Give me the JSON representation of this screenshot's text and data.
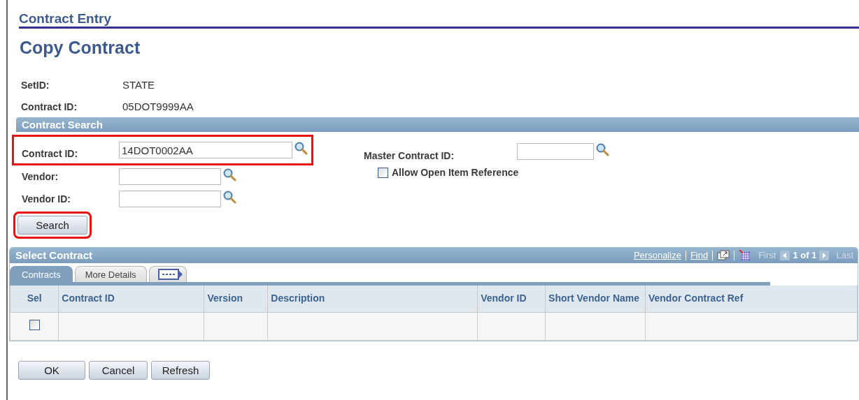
{
  "header": {
    "title": "Contract Entry"
  },
  "page_title": "Copy Contract",
  "info": [
    {
      "label": "SetID:",
      "value": "STATE"
    },
    {
      "label": "Contract ID:",
      "value": "05DOT9999AA"
    }
  ],
  "search_section": {
    "title": "Contract Search",
    "fields": [
      {
        "label": "Contract ID:",
        "value": "14DOT0002AA",
        "highlighted": true
      },
      {
        "label": "Vendor:",
        "highlighted": false
      },
      {
        "label": "Vendor ID:",
        "highlighted": false
      }
    ],
    "master_field": {
      "label": "Master Contract ID:"
    },
    "checkbox": {
      "label": "Allow Open Item Reference",
      "checked": false
    },
    "search_button": {
      "label": "Search",
      "highlighted": true
    }
  },
  "grid": {
    "title": "Select Contract",
    "links": [
      "Personalize",
      "Find"
    ],
    "nav": {
      "first": "First",
      "count": "1 of 1",
      "last": "Last"
    },
    "tabs": [
      {
        "label": "Contracts",
        "selected": true
      },
      {
        "label": "More Details",
        "selected": false
      }
    ],
    "columns": [
      "Sel",
      "Contract ID",
      "Version",
      "Description",
      "Vendor ID",
      "Short Vendor Name",
      "Vendor Contract Ref"
    ],
    "rows": [
      {
        "checked": false
      }
    ]
  },
  "buttons": [
    "OK",
    "Cancel",
    "Refresh"
  ]
}
